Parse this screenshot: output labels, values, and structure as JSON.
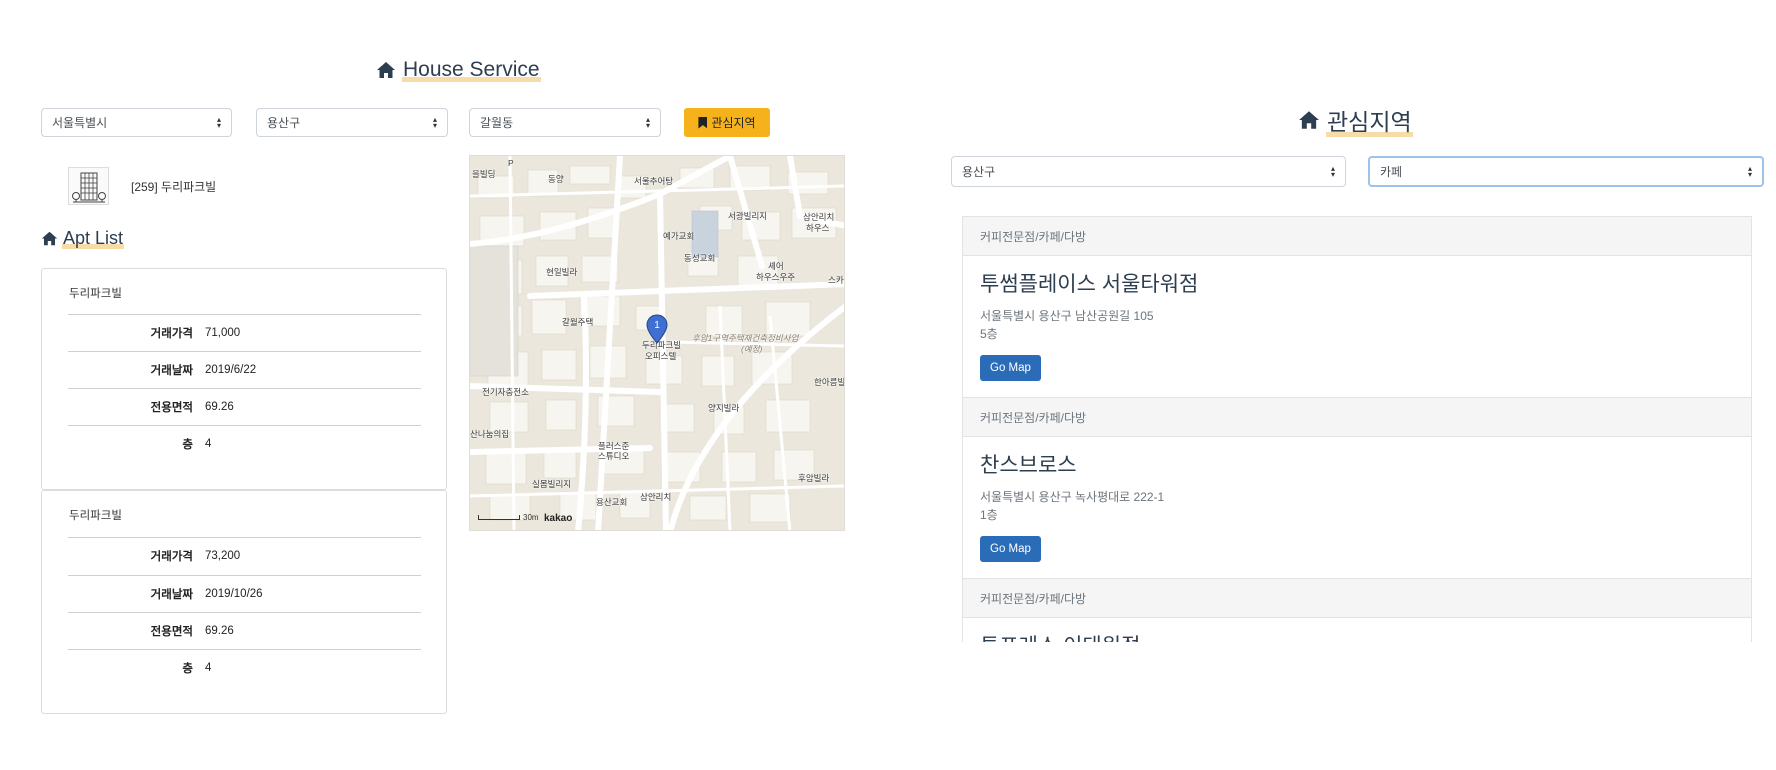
{
  "header": {
    "title": "House Service"
  },
  "filters": {
    "sido": "서울특별시",
    "gugun": "용산구",
    "dong": "갈월동",
    "favorite_button": "관심지역"
  },
  "apartment": {
    "label": "[259] 두리파크빌"
  },
  "apt_list": {
    "title": "Apt List",
    "items": [
      {
        "name": "두리파크빌",
        "rows": [
          {
            "key": "거래가격",
            "value": "71,000"
          },
          {
            "key": "거래날짜",
            "value": "2019/6/22"
          },
          {
            "key": "전용면적",
            "value": "69.26"
          },
          {
            "key": "층",
            "value": "4"
          }
        ]
      },
      {
        "name": "두리파크빌",
        "rows": [
          {
            "key": "거래가격",
            "value": "73,200"
          },
          {
            "key": "거래날짜",
            "value": "2019/10/26"
          },
          {
            "key": "전용면적",
            "value": "69.26"
          },
          {
            "key": "층",
            "value": "4"
          }
        ]
      }
    ]
  },
  "map": {
    "labels": [
      "동양",
      "서울추어탕",
      "서광빌리지",
      "삼안리치",
      "하우스",
      "예가교회",
      "동성교회",
      "셰어",
      "하우스우주",
      "현일빌라",
      "갈월주택",
      "두리파크빌",
      "오피스텔",
      "후암1구역주택재건축정비사업",
      "(예정)",
      "한아름빌",
      "전기자충전소",
      "양지빌라",
      "산나눔의집",
      "플러스준",
      "스튜디오",
      "실몸빌리지",
      "용산교회",
      "삼안리치",
      "후암빌라",
      "스카",
      "P",
      "을빌딩"
    ],
    "marker_number": "1",
    "scale": "30m",
    "provider": "kakao"
  },
  "favorites": {
    "title": "관심지역",
    "area_select": "용산구",
    "category_select": "카페",
    "stores": [
      {
        "category": "커피전문점/카페/다방",
        "name": "투썸플레이스 서울타워점",
        "address": "서울특별시 용산구 남산공원길 105",
        "floor": "5층",
        "button": "Go Map"
      },
      {
        "category": "커피전문점/카페/다방",
        "name": "찬스브로스",
        "address": "서울특별시 용산구 녹사평대로 222-1",
        "floor": "1층",
        "button": "Go Map"
      },
      {
        "category": "커피전문점/카페/다방",
        "name": "투프레소 이태원점",
        "address": "",
        "floor": "",
        "button": ""
      }
    ]
  }
}
